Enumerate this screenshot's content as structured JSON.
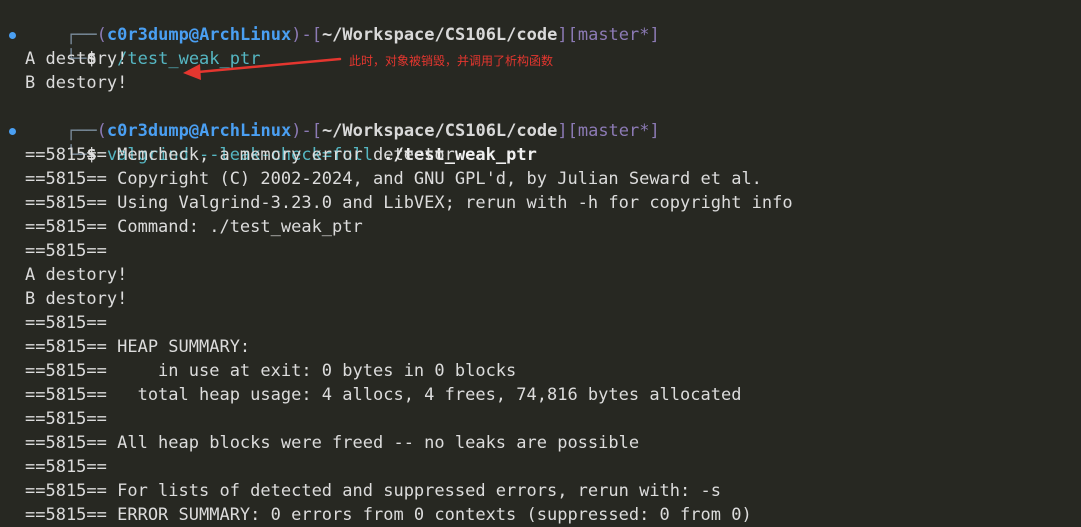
{
  "prompt": {
    "corner_top": "┌──",
    "corner_bottom": "└─",
    "open_paren": "(",
    "close_paren": ")",
    "user": "c0r3dump",
    "at": "@",
    "host": "ArchLinux",
    "separator": "-",
    "open_bracket": "[",
    "close_bracket": "]",
    "path": "~/Workspace/CS106L/code",
    "branch_open": "[",
    "branch": "master*",
    "branch_close": "]",
    "dollar": "$"
  },
  "session1": {
    "command": "./test_weak_ptr",
    "output": [
      "A destory!",
      "B destory!"
    ]
  },
  "annotation": {
    "text": "此时，对象被销毁，并调用了析构函数",
    "color": "#e4362f"
  },
  "session2": {
    "command_prefix": "valgrind --leak-check=full",
    "command_arg": "./test_weak_ptr",
    "output": [
      "==5815== Memcheck, a memory error detector",
      "==5815== Copyright (C) 2002-2024, and GNU GPL'd, by Julian Seward et al.",
      "==5815== Using Valgrind-3.23.0 and LibVEX; rerun with -h for copyright info",
      "==5815== Command: ./test_weak_ptr",
      "==5815==",
      "A destory!",
      "B destory!",
      "==5815==",
      "==5815== HEAP SUMMARY:",
      "==5815==     in use at exit: 0 bytes in 0 blocks",
      "==5815==   total heap usage: 4 allocs, 4 frees, 74,816 bytes allocated",
      "==5815==",
      "==5815== All heap blocks were freed -- no leaks are possible",
      "==5815==",
      "==5815== For lists of detected and suppressed errors, rerun with: -s",
      "==5815== ERROR SUMMARY: 0 errors from 0 contexts (suppressed: 0 from 0)"
    ]
  },
  "colors": {
    "background": "#272822",
    "prompt_accent": "#4a9ff2",
    "bracket": "#8c7ab5",
    "command": "#55b6c2",
    "arrow": "#e4362f"
  }
}
